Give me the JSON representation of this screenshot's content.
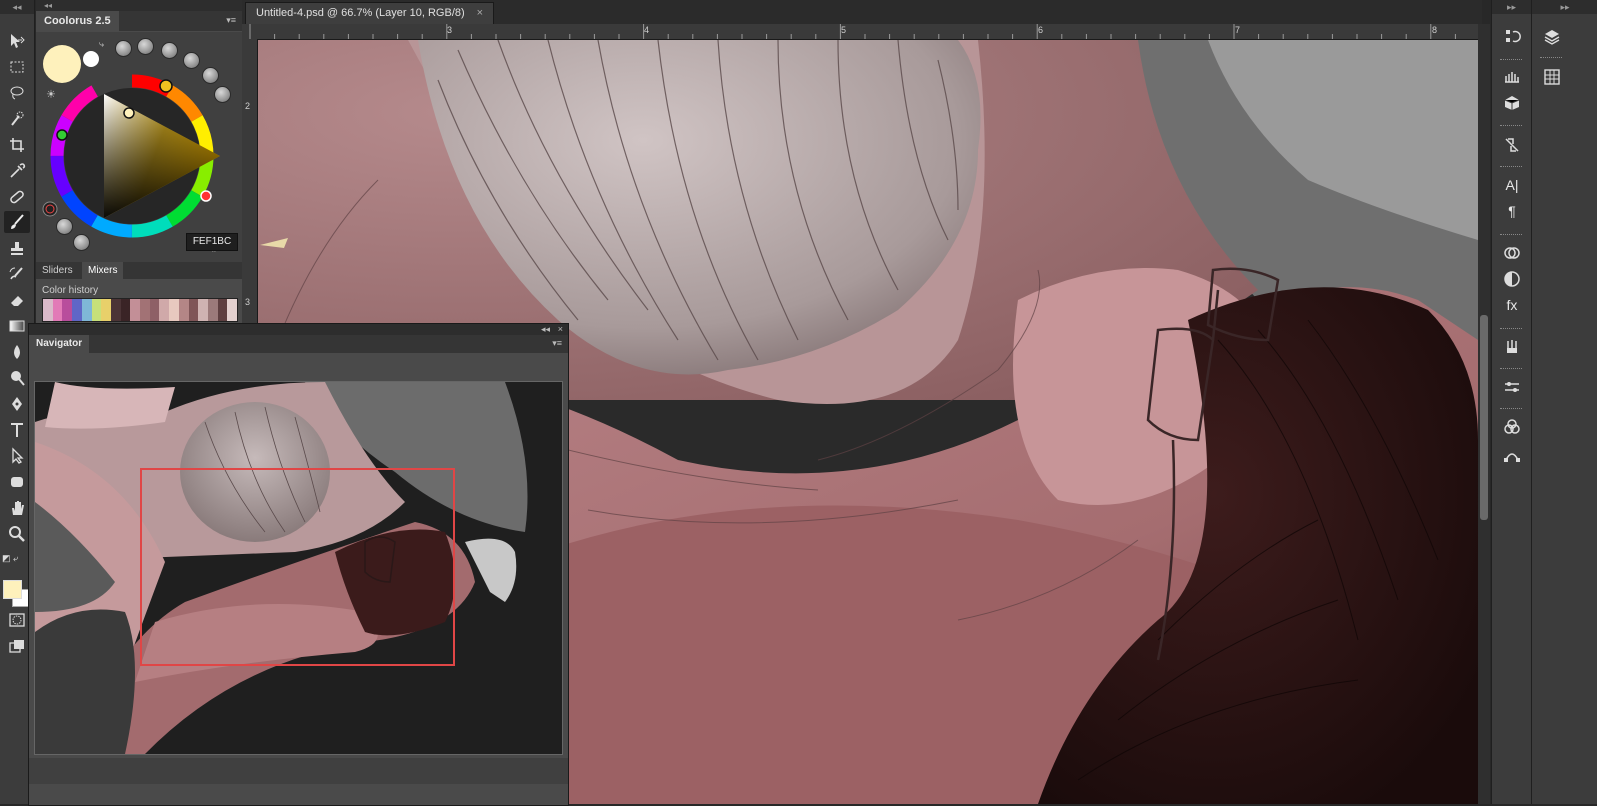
{
  "document": {
    "tab_title": "Untitled-4.psd @ 66.7% (Layer 10, RGB/8)",
    "close_glyph": "×"
  },
  "rulers": {
    "horizontal": [
      "3",
      "4",
      "5",
      "6",
      "7",
      "8"
    ],
    "vertical": [
      "2",
      "3"
    ]
  },
  "coolorus": {
    "title": "Coolorus 2.5",
    "hex_prefix": "#",
    "hex_value": "FEF1BC",
    "current_color": "#FEF1BC",
    "tabs": [
      "Sliders",
      "Mixers"
    ],
    "active_tab": "Mixers",
    "history_label": "Color history",
    "history_colors": [
      "#d9b9c9",
      "#e27ab7",
      "#b84d9c",
      "#5f66c7",
      "#7fb7d7",
      "#c7e07a",
      "#e8d06a",
      "#4b3436",
      "#3a2426",
      "#c38f97",
      "#a27275",
      "#8e6066",
      "#d0a9a9",
      "#e8c9bf",
      "#b48686",
      "#7f5557",
      "#cfb3b2",
      "#9b7a7a",
      "#5e3f40",
      "#e3d1cf"
    ]
  },
  "navigator": {
    "title": "Navigator",
    "collapse_glyph": "◂◂",
    "close_glyph": "×"
  },
  "colors": {
    "foreground": "#FEF1BC",
    "background": "#FFFFFF",
    "nav_frame": "#e04646"
  },
  "tools": [
    "move-tool",
    "marquee-tool",
    "lasso-tool",
    "quick-selection-tool",
    "crop-tool",
    "eyedropper-tool",
    "healing-brush-tool",
    "brush-tool",
    "clone-stamp-tool",
    "history-brush-tool",
    "eraser-tool",
    "gradient-tool",
    "blur-tool",
    "dodge-tool",
    "pen-tool",
    "type-tool",
    "path-selection-tool",
    "shape-tool",
    "hand-tool",
    "zoom-tool"
  ],
  "active_tool": "brush-tool",
  "dock_icons": [
    "history-icon",
    "layers-icon",
    "actions-icon",
    "3d-icon",
    "clone-source-icon",
    "character-icon",
    "paragraph-icon",
    "libraries-icon",
    "adjustments-icon",
    "styles-icon",
    "brush-presets-icon",
    "properties-icon",
    "channels-icon",
    "paths-icon"
  ]
}
